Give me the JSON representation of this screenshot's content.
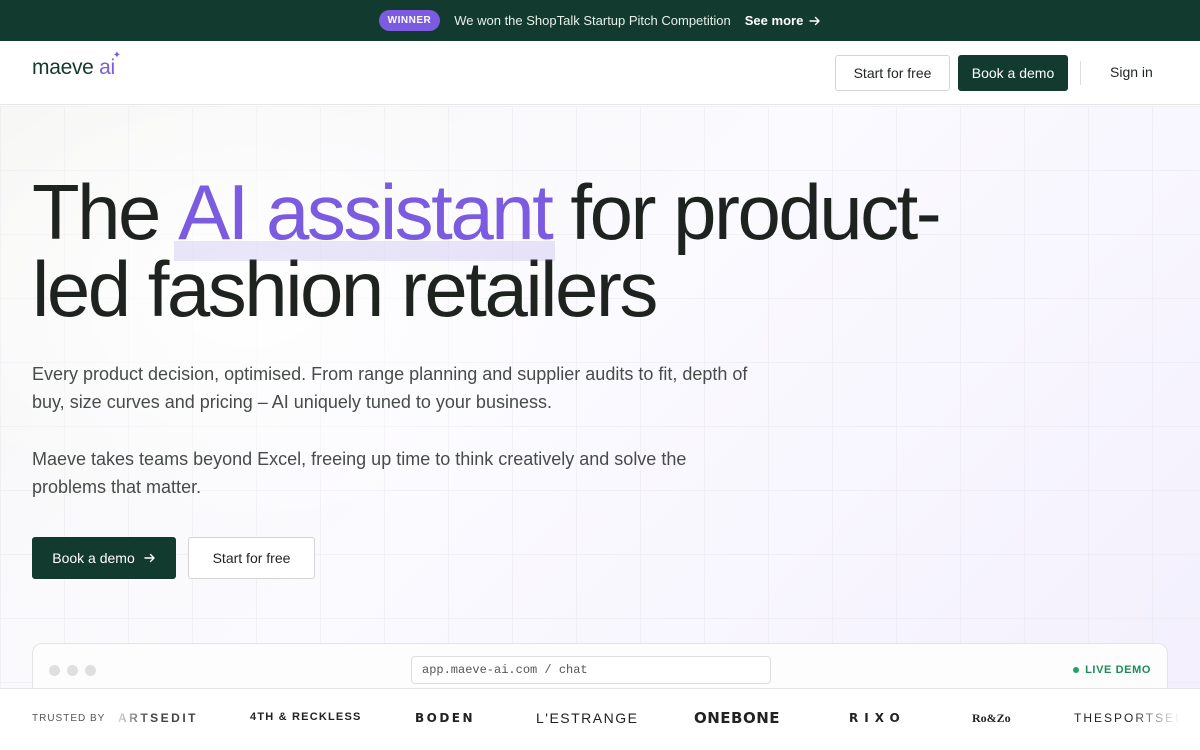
{
  "announcement": {
    "badge": "WINNER",
    "text": "We won the ShopTalk Startup Pitch Competition",
    "link": "See more"
  },
  "nav": {
    "logo_main": "maeve",
    "logo_ai": "ai",
    "start_free": "Start for free",
    "book_demo": "Book a demo",
    "sign_in": "Sign in"
  },
  "hero": {
    "headline_pre": "The ",
    "headline_highlight": "AI assistant",
    "headline_post": " for product-led fashion retailers",
    "paragraph_1": "Every product decision, optimised. From range planning and supplier audits to fit, depth of buy, size curves and pricing – AI uniquely tuned to your business.",
    "paragraph_2": "Maeve takes teams beyond Excel, freeing up time to think creatively and solve the problems that matter.",
    "cta_demo": "Book a demo",
    "cta_free": "Start for free"
  },
  "browser": {
    "url": "app.maeve-ai.com / chat",
    "live_label": "LIVE DEMO"
  },
  "trusted": {
    "label": "TRUSTED BY",
    "brands": [
      "ARTSEDIT",
      "4TH & RECKLESS",
      "BODEN",
      "L'ESTRANGE",
      "ONEBONE",
      "RIXO",
      "Ro&Zo",
      "THESPORTSEDIT"
    ]
  },
  "colors": {
    "brand_green": "#123a2e",
    "accent_purple": "#7b5ce0",
    "live_green": "#1fa463"
  }
}
